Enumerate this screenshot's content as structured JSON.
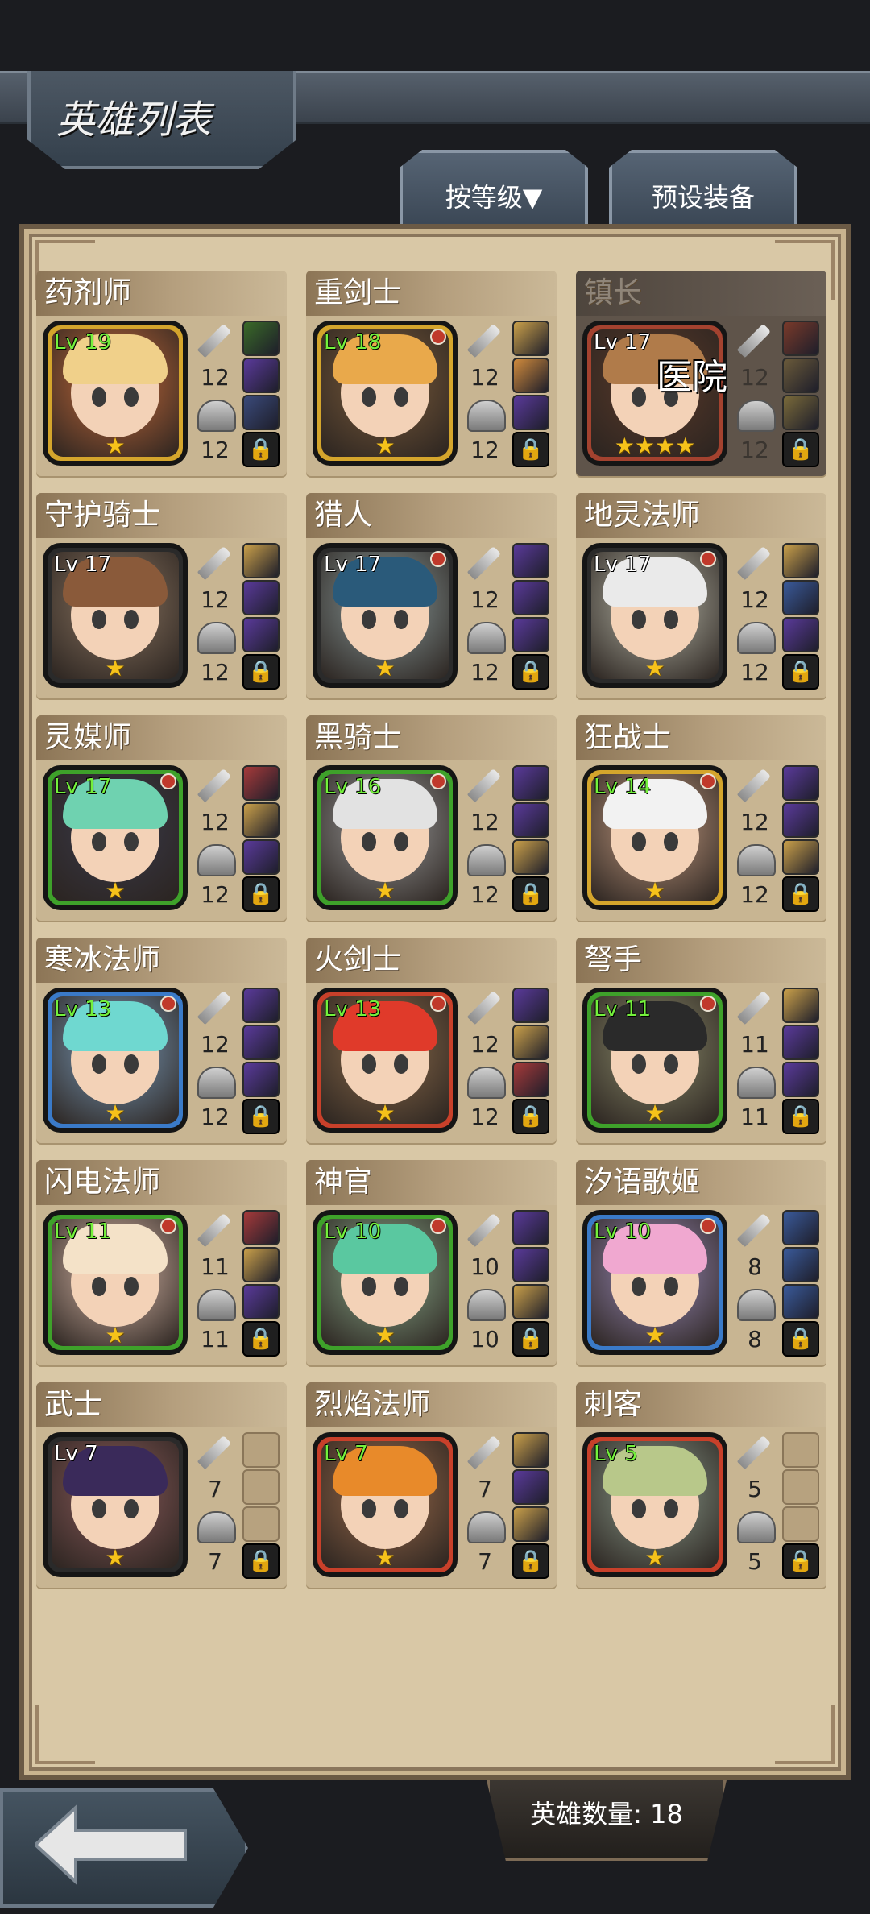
{
  "header": {
    "title": "英雄列表"
  },
  "buttons": {
    "sort": "按等级▼",
    "preset": "预设装备"
  },
  "heroes": [
    {
      "name": "药剂师",
      "level": "Lv 19",
      "stars": "★",
      "attack": "12",
      "defense": "12",
      "frame": "#d4a52c",
      "bg": "#c56a3a",
      "hair": "#f0d08a",
      "dim": false,
      "status": "",
      "slots": [
        "#3a6a28",
        "#5a3a9a",
        "#3a4a7a",
        "lock"
      ]
    },
    {
      "name": "重剑士",
      "level": "Lv 18",
      "stars": "★",
      "attack": "12",
      "defense": "12",
      "frame": "#d4a52c",
      "bg": "#7a5b3b",
      "hair": "#e9a94b",
      "dim": false,
      "status": "",
      "slots": [
        "#caa04a",
        "#d08a3c",
        "#5a3a9a",
        "lock"
      ]
    },
    {
      "name": "镇长",
      "level": "Lv 17",
      "stars": "★★★★",
      "attack": "12",
      "defense": "12",
      "frame": "#a3422f",
      "bg": "#5b3a2a",
      "hair": "#b07b4a",
      "dim": true,
      "status": "医院",
      "slots": [
        "#7a3a2a",
        "#6a5a3a",
        "#7a6a3a",
        "lock"
      ]
    },
    {
      "name": "守护骑士",
      "level": "Lv 17",
      "stars": "★",
      "attack": "12",
      "defense": "12",
      "frame": "#2a2a2a",
      "bg": "#8a7460",
      "hair": "#8a5a3a",
      "dim": false,
      "status": "",
      "slots": [
        "#caa04a",
        "#5a3a9a",
        "#5a3a9a",
        "lock"
      ]
    },
    {
      "name": "猎人",
      "level": "Lv 17",
      "stars": "★",
      "attack": "12",
      "defense": "12",
      "frame": "#2a2a2a",
      "bg": "#8a9a9a",
      "hair": "#2a5a7a",
      "dim": false,
      "status": "",
      "slots": [
        "#5a3a9a",
        "#5a3a9a",
        "#5a3a9a",
        "lock"
      ]
    },
    {
      "name": "地灵法师",
      "level": "Lv 17",
      "stars": "★",
      "attack": "12",
      "defense": "12",
      "frame": "#2a2a2a",
      "bg": "#b7b7a8",
      "hair": "#eaeaea",
      "dim": false,
      "status": "",
      "slots": [
        "#caa04a",
        "#3a5a9a",
        "#5a3a9a",
        "lock"
      ]
    },
    {
      "name": "灵媒师",
      "level": "Lv 17",
      "stars": "★",
      "attack": "12",
      "defense": "12",
      "frame": "#3ea12a",
      "bg": "#3a3a4a",
      "hair": "#6fd2b0",
      "dim": false,
      "status": "",
      "slots": [
        "#a63a3a",
        "#caa04a",
        "#5a3a9a",
        "lock"
      ]
    },
    {
      "name": "黑骑士",
      "level": "Lv 16",
      "stars": "★",
      "attack": "12",
      "defense": "12",
      "frame": "#3ea12a",
      "bg": "#9a9a9a",
      "hair": "#e2e2e2",
      "dim": false,
      "status": "",
      "slots": [
        "#5a3a9a",
        "#5a3a9a",
        "#caa04a",
        "lock"
      ]
    },
    {
      "name": "狂战士",
      "level": "Lv 14",
      "stars": "★",
      "attack": "12",
      "defense": "12",
      "frame": "#d4a52c",
      "bg": "#c29a80",
      "hair": "#f2f2f2",
      "dim": false,
      "status": "",
      "slots": [
        "#5a3a9a",
        "#5a3a9a",
        "#caa04a",
        "lock"
      ]
    },
    {
      "name": "寒冰法师",
      "level": "Lv 13",
      "stars": "★",
      "attack": "12",
      "defense": "12",
      "frame": "#3a7ac8",
      "bg": "#7a9ab8",
      "hair": "#6fd8d0",
      "dim": false,
      "status": "",
      "slots": [
        "#5a3a9a",
        "#5a3a9a",
        "#5a3a9a",
        "lock"
      ]
    },
    {
      "name": "火剑士",
      "level": "Lv 13",
      "stars": "★",
      "attack": "12",
      "defense": "12",
      "frame": "#c8402a",
      "bg": "#8a6a4a",
      "hair": "#e03a2a",
      "dim": false,
      "status": "",
      "slots": [
        "#5a3a9a",
        "#caa04a",
        "#a63a3a",
        "lock"
      ]
    },
    {
      "name": "弩手",
      "level": "Lv 11",
      "stars": "★",
      "attack": "11",
      "defense": "11",
      "frame": "#3ea12a",
      "bg": "#8a8a6a",
      "hair": "#2a2a2a",
      "dim": false,
      "status": "",
      "slots": [
        "#caa04a",
        "#5a3a9a",
        "#5a3a9a",
        "lock"
      ]
    },
    {
      "name": "闪电法师",
      "level": "Lv 11",
      "stars": "★",
      "attack": "11",
      "defense": "11",
      "frame": "#3ea12a",
      "bg": "#d8b8a8",
      "hair": "#f4e2c8",
      "dim": false,
      "status": "",
      "slots": [
        "#a63a3a",
        "#caa04a",
        "#5a3a9a",
        "lock"
      ]
    },
    {
      "name": "神官",
      "level": "Lv 10",
      "stars": "★",
      "attack": "10",
      "defense": "10",
      "frame": "#3ea12a",
      "bg": "#8aaa8a",
      "hair": "#5ac8a0",
      "dim": false,
      "status": "",
      "slots": [
        "#5a3a9a",
        "#5a3a9a",
        "#caa04a",
        "lock"
      ]
    },
    {
      "name": "汐语歌姬",
      "level": "Lv 10",
      "stars": "★",
      "attack": "8",
      "defense": "8",
      "frame": "#3a7ac8",
      "bg": "#9a8ab8",
      "hair": "#f0a8d0",
      "dim": false,
      "status": "",
      "slots": [
        "#3a5a9a",
        "#3a5a9a",
        "#3a5a9a",
        "lock"
      ]
    },
    {
      "name": "武士",
      "level": "Lv 7",
      "stars": "★",
      "attack": "7",
      "defense": "7",
      "frame": "#2a2a2a",
      "bg": "#8a5a5a",
      "hair": "#3a2a5a",
      "dim": false,
      "status": "",
      "slots": [
        "empty",
        "empty",
        "empty",
        "lock"
      ]
    },
    {
      "name": "烈焰法师",
      "level": "Lv 7",
      "stars": "★",
      "attack": "7",
      "defense": "7",
      "frame": "#c8402a",
      "bg": "#9a6a4a",
      "hair": "#e88a2a",
      "dim": false,
      "status": "",
      "slots": [
        "#caa04a",
        "#5a3a9a",
        "#caa04a",
        "lock"
      ]
    },
    {
      "name": "刺客",
      "level": "Lv 5",
      "stars": "★",
      "attack": "5",
      "defense": "5",
      "frame": "#c8402a",
      "bg": "#8a9a8a",
      "hair": "#b8c88a",
      "dim": false,
      "status": "",
      "slots": [
        "empty",
        "empty",
        "empty",
        "lock"
      ]
    }
  ],
  "footer": {
    "hero_count": "英雄数量: 18"
  },
  "icons": {
    "back": "back-arrow-icon",
    "lock": "lock-icon",
    "sword": "sword-icon",
    "helmet": "helmet-icon"
  }
}
